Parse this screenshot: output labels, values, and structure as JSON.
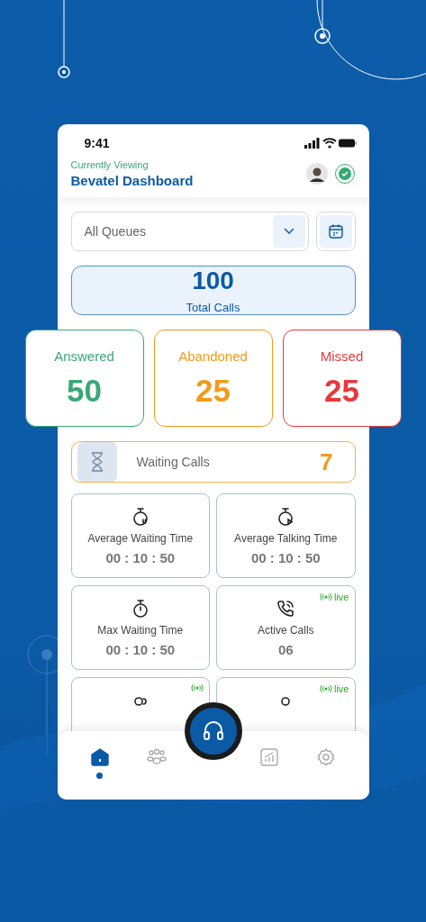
{
  "status_bar": {
    "time": "9:41"
  },
  "header": {
    "caption": "Currently Viewing",
    "title": "Bevatel Dashboard",
    "online": true
  },
  "queue_select": {
    "value": "All Queues"
  },
  "total": {
    "value": "100",
    "label": "Total Calls"
  },
  "stats": [
    {
      "label": "Answered",
      "value": "50",
      "color": "#3aa876"
    },
    {
      "label": "Abandoned",
      "value": "25",
      "color": "#f39a1c"
    },
    {
      "label": "Missed",
      "value": "25",
      "color": "#e8383d"
    }
  ],
  "waiting": {
    "label": "Waiting Calls",
    "value": "7"
  },
  "metrics": [
    {
      "kind": "timerpause",
      "label": "Average Waiting Time",
      "value": "00 : 10 : 50",
      "live": false
    },
    {
      "kind": "timerplay",
      "label": "Average Talking Time",
      "value": "00 : 10 : 50",
      "live": false
    },
    {
      "kind": "timer",
      "label": "Max Waiting Time",
      "value": "00 : 10 : 50",
      "live": false
    },
    {
      "kind": "phone",
      "label": "Active Calls",
      "value": "06",
      "live": true,
      "badge": "live"
    },
    {
      "kind": "people",
      "live": true
    },
    {
      "kind": "person",
      "live": true,
      "badge": "live"
    }
  ],
  "nav": [
    {
      "kind": "home",
      "selected": true
    },
    {
      "kind": "team",
      "selected": false
    },
    {
      "kind": "center",
      "selected": false
    },
    {
      "kind": "chart",
      "selected": false
    },
    {
      "kind": "settings",
      "selected": false
    }
  ]
}
